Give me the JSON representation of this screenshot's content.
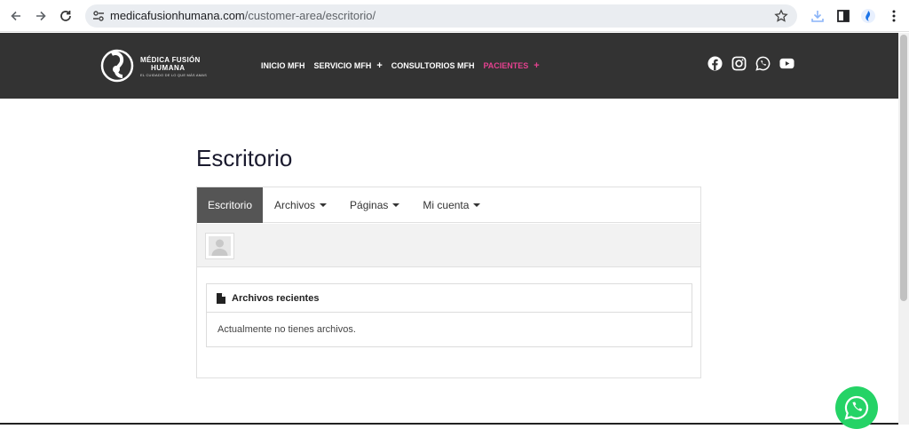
{
  "browser": {
    "url_host": "medicafusionhumana.com",
    "url_path": "/customer-area/escritorio/"
  },
  "header": {
    "logo_line1": "MÉDICA FUSIÓN",
    "logo_line2": "HUMANA",
    "logo_tagline": "EL CUIDADO DE LO QUE MÁS AMAS",
    "nav": [
      {
        "label": "INICIO MFH",
        "plus": ""
      },
      {
        "label": "SERVICIO MFH",
        "plus": "+"
      },
      {
        "label": "CONSULTORIOS MFH",
        "plus": ""
      },
      {
        "label": "PACIENTES",
        "plus": "+"
      }
    ],
    "social_icons": [
      "facebook-icon",
      "instagram-icon",
      "whatsapp-icon",
      "youtube-icon"
    ],
    "active_color": "#e4418f"
  },
  "page": {
    "title": "Escritorio",
    "tabs": [
      {
        "label": "Escritorio"
      },
      {
        "label": "Archivos"
      },
      {
        "label": "Páginas"
      },
      {
        "label": "Mi cuenta"
      }
    ],
    "recent_files": {
      "heading": "Archivos recientes",
      "empty_message": "Actualmente no tienes archivos."
    }
  }
}
